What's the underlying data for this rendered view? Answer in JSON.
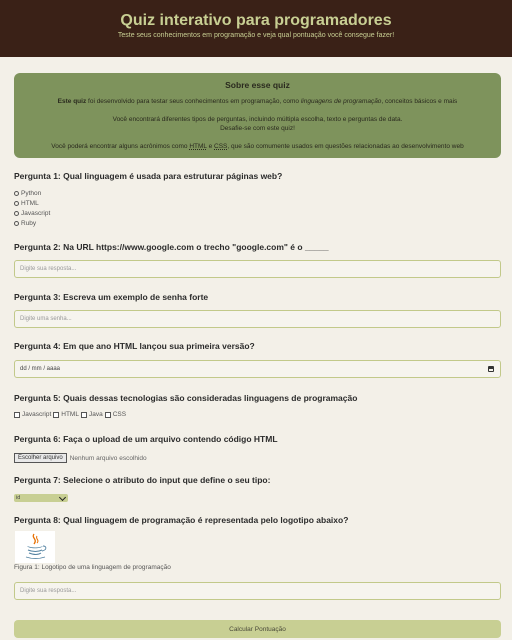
{
  "header": {
    "title": "Quiz interativo para programadores",
    "subtitle": "Teste seus conhecimentos em programação e veja qual pontuação você consegue fazer!"
  },
  "about": {
    "title": "Sobre esse quiz",
    "line1_bold": "Este quiz",
    "line1_rest": " foi desenvolvido para testar seus conhecimentos em programação, como ",
    "line1_italic": "linguagens de programação",
    "line1_end": ", conceitos básicos e mais",
    "line2": "Você encontrará diferentes tipos de perguntas, incluindo múltipla escolha, texto e perguntas de data.",
    "line3": "Desafie-se com este quiz!",
    "line4_start": "Você poderá encontrar alguns acrônimos como ",
    "abbr1": "HTML",
    "line4_mid": " e ",
    "abbr2": "CSS",
    "line4_end": ", que são comumente usados em questões relacionadas ao desenvolvimento web"
  },
  "q1": {
    "label": "Pergunta 1: Qual linguagem é usada para estruturar páginas web?",
    "options": [
      "Python",
      "HTML",
      "Javascript",
      "Ruby"
    ]
  },
  "q2": {
    "label": "Pergunta 2: Na URL https://www.google.com o trecho \"google.com\" é o _____",
    "placeholder": "Digite sua resposta..."
  },
  "q3": {
    "label": "Pergunta 3: Escreva um exemplo de senha forte",
    "placeholder": "Digite uma senha..."
  },
  "q4": {
    "label": "Pergunta 4: Em que ano HTML lançou sua primeira versão?",
    "placeholder": "dd / mm / aaaa"
  },
  "q5": {
    "label": "Pergunta 5: Quais dessas tecnologias são consideradas linguagens de programação",
    "options": [
      "Javascript",
      "HTML",
      "Java",
      "CSS"
    ]
  },
  "q6": {
    "label": "Pergunta 6: Faça o upload de um arquivo contendo código HTML",
    "button": "Escolher arquivo",
    "status": "Nenhum arquivo escolhido"
  },
  "q7": {
    "label": "Pergunta 7: Selecione o atributo do input que define o seu tipo:",
    "selected": "id"
  },
  "q8": {
    "label": "Pergunta 8: Qual linguagem de programação é representada pelo logotipo abaixo?",
    "caption": "Figura 1: Logotipo de uma linguagem de programação",
    "placeholder": "Digite sua resposta...",
    "logo_icon": "java-logo-icon"
  },
  "submit": {
    "label": "Calcular Pontuação"
  },
  "colors": {
    "header_bg": "#3a2117",
    "accent": "#c8cf93",
    "about_bg": "#7e935c",
    "page_bg": "#f3f0e8"
  }
}
